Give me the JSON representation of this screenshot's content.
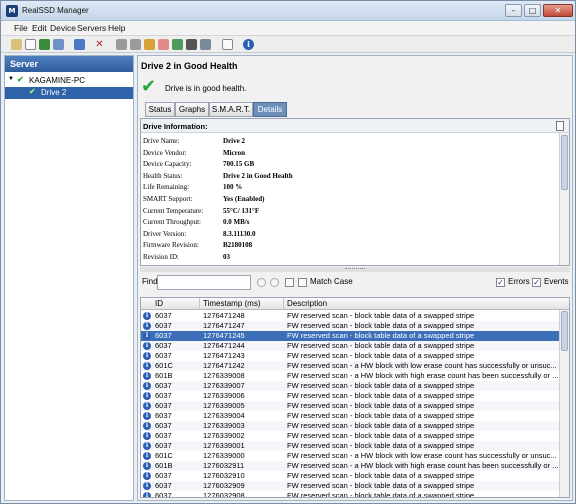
{
  "window": {
    "title": "RealSSD Manager",
    "app_icon": "M",
    "minimize": "–",
    "maximize": "□",
    "close": "✕"
  },
  "menu": [
    "File",
    "Edit",
    "Device",
    "Servers",
    "Help"
  ],
  "toolbar_icons": [
    "open-icon",
    "new-icon",
    "save-icon",
    "export-icon",
    "refresh-icon",
    "delete-icon",
    "disk-icon",
    "disk2-icon",
    "wand-icon",
    "erase-icon",
    "upload-icon",
    "camera-icon",
    "window-icon",
    "document-icon",
    "info-icon"
  ],
  "server_panel": {
    "header": "Server",
    "nodes": [
      {
        "label": "KAGAMINE-PC",
        "expander": "▼",
        "status": "✔"
      },
      {
        "label": "Drive 2",
        "status": "✔"
      }
    ]
  },
  "drive": {
    "title": "Drive 2 in Good Health",
    "health_icon": "✔",
    "health_text": "Drive is in good health.",
    "tabs": [
      "Status",
      "Graphs",
      "S.M.A.R.T.",
      "Details"
    ],
    "active_tab": "Details"
  },
  "drive_info": {
    "heading": "Drive Information:",
    "rows": [
      {
        "label": "Drive Name:",
        "value": "Drive 2"
      },
      {
        "label": "Device Vendor:",
        "value": "Micron"
      },
      {
        "label": "Device Capacity:",
        "value": "700.15 GB"
      },
      {
        "label": "Health Status:",
        "value": "Drive 2 in Good Health"
      },
      {
        "label": "Life Remaining:",
        "value": "100 %"
      },
      {
        "label": "SMART Support:",
        "value": "Yes (Enabled)"
      },
      {
        "label": "Current Temperature:",
        "value": "55°C/ 131°F"
      },
      {
        "label": "Current Throughput:",
        "value": "0.0 MB/s"
      },
      {
        "label": "Driver Version:",
        "value": "8.3.11130.0"
      },
      {
        "label": "Firmware Revision:",
        "value": "B2180108"
      },
      {
        "label": "Revision ID:",
        "value": "03"
      }
    ]
  },
  "find": {
    "label": "Find:",
    "value": "",
    "match_case": "Match Case",
    "errors": "Errors",
    "events": "Events",
    "errors_checked": true,
    "events_checked": true,
    "match_case_checked": false
  },
  "log_table": {
    "columns": [
      "ID",
      "Timestamp (ms)",
      "Description"
    ],
    "rows": [
      {
        "id": "6037",
        "ts": "1276471248",
        "desc": "FW reserved scan - block table data of a swapped stripe"
      },
      {
        "id": "6037",
        "ts": "1276471247",
        "desc": "FW reserved scan - block table data of a swapped stripe"
      },
      {
        "id": "6037",
        "ts": "1276471245",
        "desc": "FW reserved scan - block table data of a swapped stripe",
        "selected": true
      },
      {
        "id": "6037",
        "ts": "1276471244",
        "desc": "FW reserved scan - block table data of a swapped stripe"
      },
      {
        "id": "6037",
        "ts": "1276471243",
        "desc": "FW reserved scan - block table data of a swapped stripe"
      },
      {
        "id": "601C",
        "ts": "1276471242",
        "desc": "FW reserved scan - a HW block with low erase count has successfully or unsuc..."
      },
      {
        "id": "601B",
        "ts": "1276339008",
        "desc": "FW reserved scan - a HW block with high erase count has been successfully or ..."
      },
      {
        "id": "6037",
        "ts": "1276339007",
        "desc": "FW reserved scan - block table data of a swapped stripe"
      },
      {
        "id": "6037",
        "ts": "1276339006",
        "desc": "FW reserved scan - block table data of a swapped stripe"
      },
      {
        "id": "6037",
        "ts": "1276339005",
        "desc": "FW reserved scan - block table data of a swapped stripe"
      },
      {
        "id": "6037",
        "ts": "1276339004",
        "desc": "FW reserved scan - block table data of a swapped stripe"
      },
      {
        "id": "6037",
        "ts": "1276339003",
        "desc": "FW reserved scan - block table data of a swapped stripe"
      },
      {
        "id": "6037",
        "ts": "1276339002",
        "desc": "FW reserved scan - block table data of a swapped stripe"
      },
      {
        "id": "6037",
        "ts": "1276339001",
        "desc": "FW reserved scan - block table data of a swapped stripe"
      },
      {
        "id": "601C",
        "ts": "1276339000",
        "desc": "FW reserved scan - a HW block with low erase count has successfully or unsuc..."
      },
      {
        "id": "601B",
        "ts": "1276032911",
        "desc": "FW reserved scan - a HW block with high erase count has been successfully or ..."
      },
      {
        "id": "6037",
        "ts": "1276032910",
        "desc": "FW reserved scan - block table data of a swapped stripe"
      },
      {
        "id": "6037",
        "ts": "1276032909",
        "desc": "FW reserved scan - block table data of a swapped stripe"
      },
      {
        "id": "6037",
        "ts": "1276032908",
        "desc": "FW reserved scan - block table data of a swapped stripe"
      }
    ]
  },
  "colors": {
    "selection": "#3c6fb8",
    "health_green": "#28a834",
    "info_blue": "#2a5fb5",
    "header_blue": "#2f5d9c"
  }
}
